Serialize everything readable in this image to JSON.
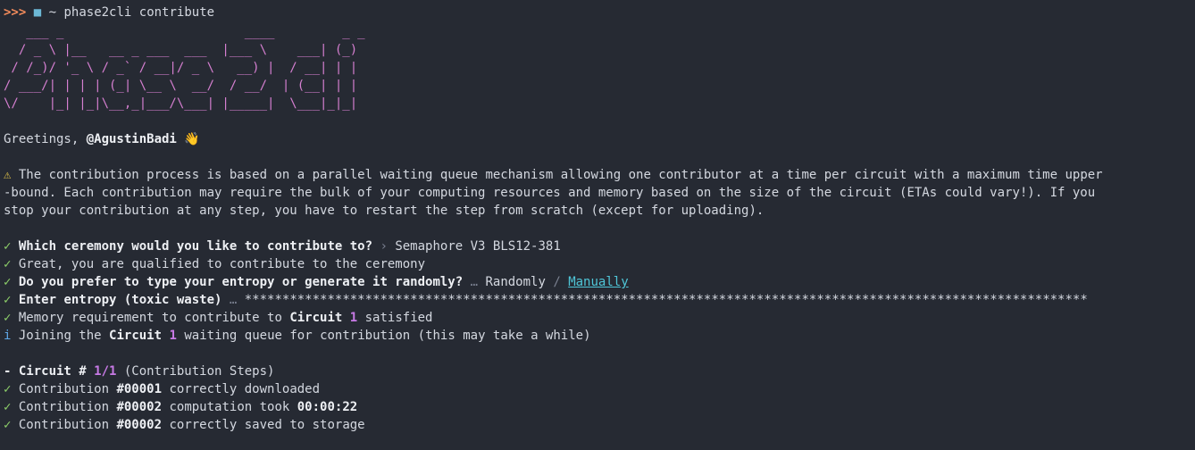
{
  "prompt": {
    "chevrons": ">>>",
    "folder_icon": "folder-icon",
    "tilde": "~",
    "command": "phase2cli contribute"
  },
  "banner_lines": [
    "   ___ _                        ____         _ _ ",
    "  / _ \\ |__   __ _ ___  ___  |___ \\    ___| (_)",
    " / /_)/ '_ \\ / _` / __|/ _ \\   __) |  / __| | |",
    "/ ___/| | | | (_| \\__ \\  __/  / __/  | (__| | |",
    "\\/    |_| |_|\\__,_|___/\\___| |_____|  \\___|_|_|"
  ],
  "greeting": {
    "text": "Greetings, ",
    "handle": "@AgustinBadi",
    "emoji": "👋"
  },
  "warning": {
    "icon": "⚠",
    "line1": " The contribution process is based on a parallel waiting queue mechanism allowing one contributor at a time per circuit with a maximum time upper",
    "line2": "-bound. Each contribution may require the bulk of your computing resources and memory based on the size of the circuit (ETAs could vary!). If you",
    "line3": "stop your contribution at any step, you have to restart the step from scratch (except for uploading)."
  },
  "steps": {
    "ceremony_q": "Which ceremony would you like to contribute to?",
    "ceremony_sep": " › ",
    "ceremony_a": "Semaphore V3 BLS12-381",
    "qualified": "Great, you are qualified to contribute to the ceremony",
    "entropy_q": "Do you prefer to type your entropy or generate it randomly?",
    "entropy_ell": " … ",
    "entropy_opt1": "Randomly",
    "entropy_slash": " / ",
    "entropy_opt2": "Manually",
    "enter_entropy": "Enter entropy (toxic waste)",
    "enter_ell": " … ",
    "entropy_mask": "****************************************************************************************************************",
    "mem_pre": "Memory requirement to contribute to ",
    "mem_circuit": "Circuit",
    "mem_num": "1",
    "mem_post": " satisfied",
    "join_pre": "Joining the ",
    "join_circuit": "Circuit",
    "join_num": "1",
    "join_post": " waiting queue for contribution (this may take a while)"
  },
  "circuit": {
    "dash": "- ",
    "label": "Circuit # ",
    "progress": "1/1",
    "suffix": " (Contribution Steps)",
    "rows": [
      {
        "pre": "Contribution ",
        "id": "#00001",
        "post": " correctly downloaded",
        "extra": ""
      },
      {
        "pre": "Contribution ",
        "id": "#00002",
        "post": " computation took ",
        "extra": "00:00:22"
      },
      {
        "pre": "Contribution ",
        "id": "#00002",
        "post": " correctly saved to storage",
        "extra": ""
      }
    ]
  },
  "glyphs": {
    "check": "✓",
    "info": "i"
  },
  "colors": {
    "background": "#262a33",
    "banner": "#d57fd0",
    "check": "#8fd16a",
    "accent_purple": "#c87ae6",
    "link": "#4fc6d8",
    "prompt_chevrons": "#f28b5b"
  }
}
